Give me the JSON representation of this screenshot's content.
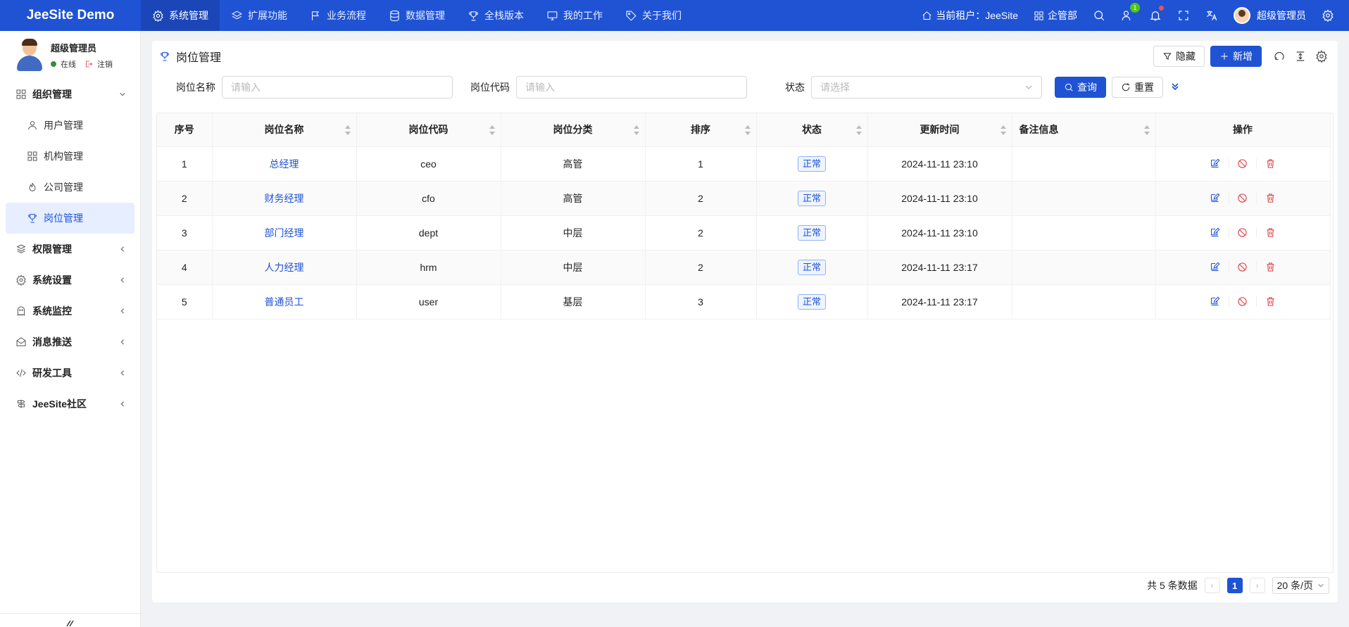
{
  "app": {
    "title": "JeeSite Demo"
  },
  "topnav": [
    {
      "label": "系统管理",
      "icon": "gear-icon",
      "active": true
    },
    {
      "label": "扩展功能",
      "icon": "layers-icon"
    },
    {
      "label": "业务流程",
      "icon": "flag-icon"
    },
    {
      "label": "数据管理",
      "icon": "database-icon"
    },
    {
      "label": "全栈版本",
      "icon": "trophy-icon"
    },
    {
      "label": "我的工作",
      "icon": "monitor-icon"
    },
    {
      "label": "关于我们",
      "icon": "tag-icon"
    }
  ],
  "topright": {
    "tenant_label": "当前租户：JeeSite",
    "dept_label": "企管部",
    "online_badge": "1",
    "user_name": "超级管理员"
  },
  "user_panel": {
    "name": "超级管理员",
    "status": "在线",
    "logout": "注销"
  },
  "sidebar": {
    "groups": [
      {
        "label": "组织管理",
        "icon": "grid-icon",
        "expanded": true,
        "children": [
          {
            "label": "用户管理",
            "icon": "user-icon"
          },
          {
            "label": "机构管理",
            "icon": "apps-icon"
          },
          {
            "label": "公司管理",
            "icon": "fire-icon"
          },
          {
            "label": "岗位管理",
            "icon": "trophy-icon",
            "active": true
          }
        ]
      },
      {
        "label": "权限管理",
        "icon": "permission-icon"
      },
      {
        "label": "系统设置",
        "icon": "settings-icon"
      },
      {
        "label": "系统监控",
        "icon": "monitor-ghost-icon"
      },
      {
        "label": "消息推送",
        "icon": "mail-icon"
      },
      {
        "label": "研发工具",
        "icon": "code-icon"
      },
      {
        "label": "JeeSite社区",
        "icon": "signpost-icon"
      }
    ]
  },
  "page": {
    "title": "岗位管理",
    "hide_button": "隐藏",
    "add_button": "新增"
  },
  "search": {
    "name_label": "岗位名称",
    "name_placeholder": "请输入",
    "code_label": "岗位代码",
    "code_placeholder": "请输入",
    "status_label": "状态",
    "status_placeholder": "请选择",
    "query_button": "查询",
    "reset_button": "重置"
  },
  "table": {
    "columns": [
      "序号",
      "岗位名称",
      "岗位代码",
      "岗位分类",
      "排序",
      "状态",
      "更新时间",
      "备注信息",
      "操作"
    ],
    "rows": [
      {
        "no": "1",
        "name": "总经理",
        "code": "ceo",
        "category": "高管",
        "sort": "1",
        "status": "正常",
        "updated": "2024-11-11 23:10",
        "remark": ""
      },
      {
        "no": "2",
        "name": "财务经理",
        "code": "cfo",
        "category": "高管",
        "sort": "2",
        "status": "正常",
        "updated": "2024-11-11 23:10",
        "remark": ""
      },
      {
        "no": "3",
        "name": "部门经理",
        "code": "dept",
        "category": "中层",
        "sort": "2",
        "status": "正常",
        "updated": "2024-11-11 23:10",
        "remark": ""
      },
      {
        "no": "4",
        "name": "人力经理",
        "code": "hrm",
        "category": "中层",
        "sort": "2",
        "status": "正常",
        "updated": "2024-11-11 23:17",
        "remark": ""
      },
      {
        "no": "5",
        "name": "普通员工",
        "code": "user",
        "category": "基层",
        "sort": "3",
        "status": "正常",
        "updated": "2024-11-11 23:17",
        "remark": ""
      }
    ]
  },
  "pagination": {
    "total_text": "共 5 条数据",
    "current_page": "1",
    "page_size": "20 条/页"
  },
  "colors": {
    "primary": "#1f53d4",
    "danger": "#e0393e"
  }
}
